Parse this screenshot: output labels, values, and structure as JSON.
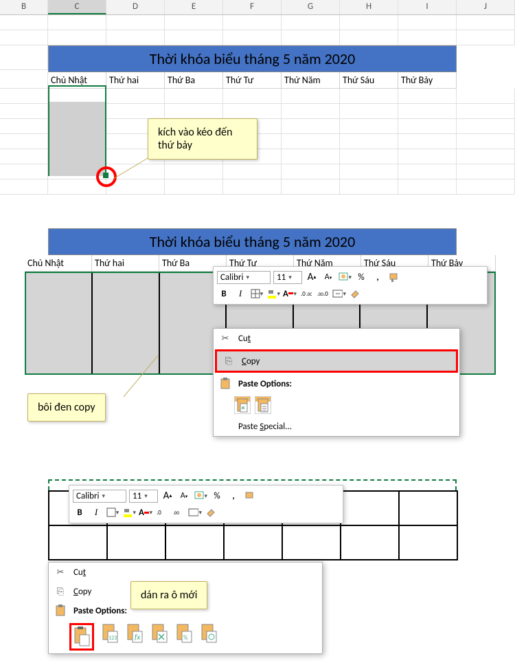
{
  "columns": [
    "B",
    "C",
    "D",
    "E",
    "F",
    "G",
    "H",
    "I",
    "J"
  ],
  "active_col": "C",
  "title": "Thời khóa biểu tháng 5 năm 2020",
  "weekdays": [
    "Chủ Nhật",
    "Thứ hai",
    "Thứ Ba",
    "Thứ Tư",
    "Thứ Năm",
    "Thứ Sáu",
    "Thứ Bảy"
  ],
  "callout1": "kích vào kéo đến thứ bảy",
  "callout2": "bôi đen copy",
  "callout3": "dán ra ô mới",
  "mini_toolbar": {
    "font": "Calibri",
    "size": "11",
    "bold": "B",
    "italic": "I",
    "pct": "%",
    "comma": ",",
    "inc_a": "A",
    "dec_a": "A"
  },
  "ctx": {
    "cut": "Cut",
    "copy": "Copy",
    "paste_options": "Paste Options:",
    "paste_special": "Paste Special...",
    "f123": "123"
  }
}
